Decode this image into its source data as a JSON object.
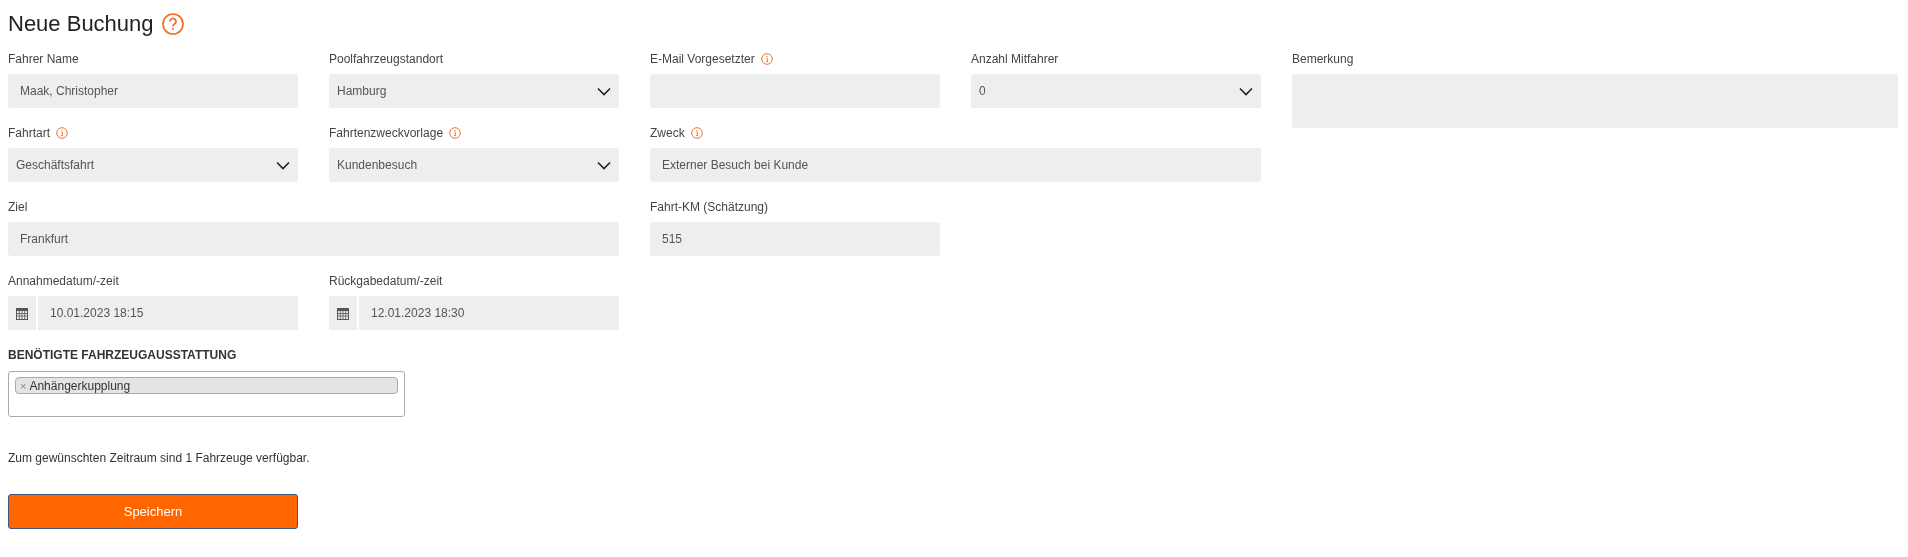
{
  "title": "Neue Buchung",
  "fields": [
    {
      "label": "Fahrer Name",
      "kind": "text",
      "info": false,
      "value": "Maak, Christopher"
    },
    {
      "label": "Poolfahrzeugstandort",
      "kind": "select",
      "info": false,
      "value": "Hamburg"
    },
    {
      "label": "E-Mail Vorgesetzter",
      "kind": "text",
      "info": true
    },
    {
      "label": "Anzahl Mitfahrer",
      "kind": "select",
      "info": false,
      "value": "0"
    },
    {
      "label": "Bemerkung",
      "kind": "textarea",
      "info": false
    },
    {
      "label": "Fahrtart",
      "kind": "select",
      "info": true,
      "value": "Geschäftsfahrt"
    },
    {
      "label": "Fahrtenzweckvorlage",
      "kind": "select",
      "info": true,
      "value": "Kundenbesuch"
    },
    {
      "label": "Zweck",
      "kind": "text",
      "info": true,
      "value": "Externer Besuch bei Kunde"
    },
    {
      "label": "Ziel",
      "kind": "text",
      "info": false,
      "value": "Frankfurt"
    },
    {
      "label": "Fahrt-KM (Schätzung)",
      "kind": "text",
      "info": false,
      "value": "515"
    },
    {
      "label": "Annahmedatum/-zeit",
      "kind": "date",
      "info": false,
      "value": "10.01.2023 18:15"
    },
    {
      "label": "Rückgabedatum/-zeit",
      "kind": "date",
      "info": false,
      "value": "12.01.2023 18:30"
    }
  ],
  "equipment": {
    "heading": "BENÖTIGTE FAHRZEUGAUSSTATTUNG",
    "tags": [
      {
        "remove": "×",
        "label": "Anhängerkupplung"
      }
    ]
  },
  "message": "Zum gewünschten Zeitraum sind 1 Fahrzeuge verfügbar.",
  "save_button": "Speichern"
}
